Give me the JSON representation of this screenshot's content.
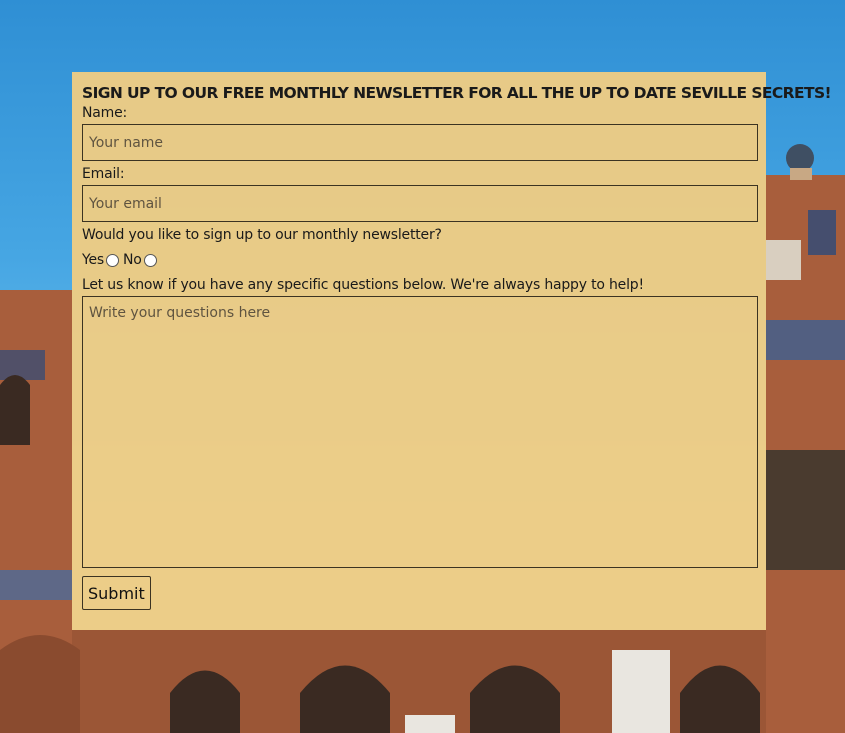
{
  "background": {
    "sky_color": "#3597d8",
    "brick_color": "#a45c3a"
  },
  "form": {
    "title": "SIGN UP TO OUR FREE MONTHLY NEWSLETTER FOR ALL THE UP TO DATE SEVILLE SECRETS!",
    "name_label": "Name:",
    "name_placeholder": "Your name",
    "email_label": "Email:",
    "email_placeholder": "Your email",
    "newsletter_question": "Would you like to sign up to our monthly newsletter?",
    "yes_label": "Yes",
    "no_label": "No",
    "questions_label": "Let us know if you have any specific questions below. We're always happy to help!",
    "questions_placeholder": "Write your questions here",
    "submit_label": "Submit",
    "panel_color": "#f4ce80"
  }
}
